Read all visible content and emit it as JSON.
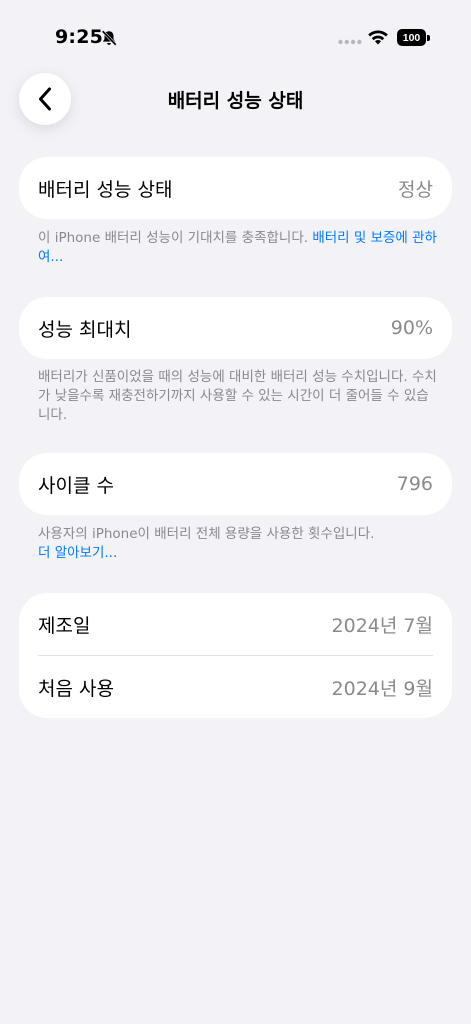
{
  "status_bar": {
    "time": "9:25",
    "battery_level": "100"
  },
  "nav": {
    "title": "배터리 성능 상태"
  },
  "health_card": {
    "label": "배터리 성능 상태",
    "value": "정상"
  },
  "health_note": {
    "text": "이 iPhone 배터리 성능이 기대치를 충족합니다. ",
    "link": "배터리 및 보증에 관하여..."
  },
  "capacity_card": {
    "label": "성능 최대치",
    "value": "90%"
  },
  "capacity_note": {
    "text": "배터리가 신품이었을 때의 성능에 대비한 배터리 성능 수치입니다. 수치가 낮을수록 재충전하기까지 사용할 수 있는 시간이 더 줄어들 수 있습니다."
  },
  "cycle_card": {
    "label": "사이클 수",
    "value": "796"
  },
  "cycle_note": {
    "text": "사용자의 iPhone이 배터리 전체 용량을 사용한 횟수입니다.",
    "link": "더 알아보기..."
  },
  "dates_card": {
    "manufacture_label": "제조일",
    "manufacture_value": "2024년 7월",
    "first_use_label": "처음 사용",
    "first_use_value": "2024년 9월"
  },
  "colors": {
    "background": "#F2F2F7",
    "card": "#FFFFFF",
    "secondary_text": "#8A8A8E",
    "link": "#007AFF"
  }
}
